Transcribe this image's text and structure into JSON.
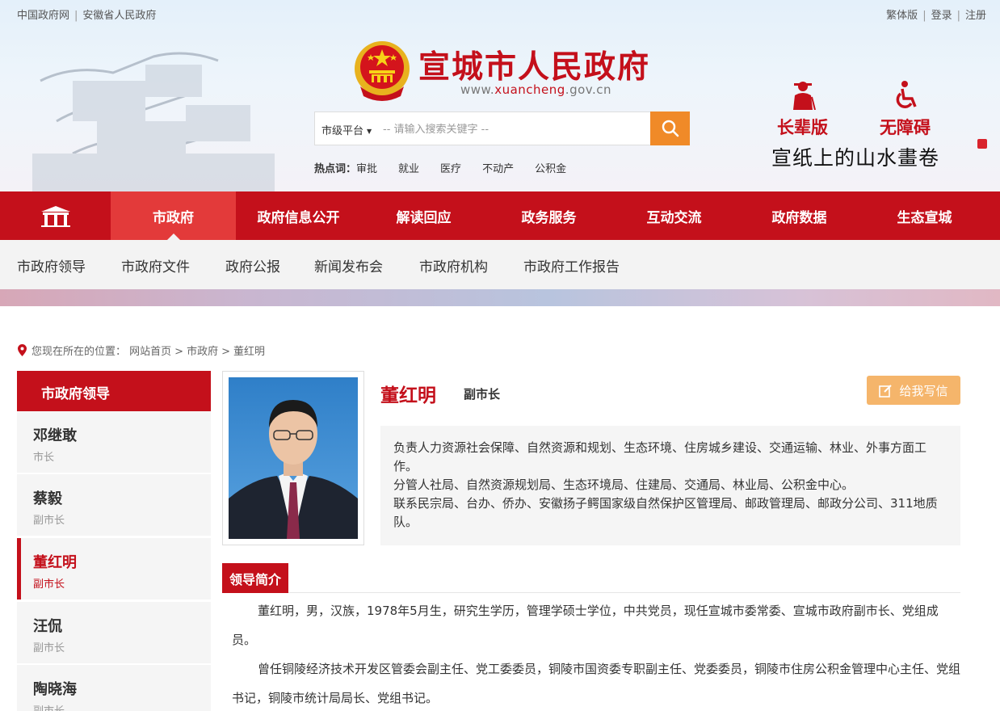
{
  "topbar": {
    "left_links": [
      "中国政府网",
      "安徽省人民政府"
    ],
    "right_links": [
      "繁体版",
      "登录",
      "注册"
    ]
  },
  "header": {
    "title": "宣城市人民政府",
    "url_prefix": "www.",
    "url_highlight": "xuancheng",
    "url_suffix": ".gov.cn",
    "search": {
      "scope": "市级平台",
      "placeholder": "-- 请输入搜索关键字 --"
    },
    "hot_label": "热点词：",
    "hot_words": [
      "审批",
      "就业",
      "医疗",
      "不动产",
      "公积金"
    ],
    "access": {
      "elder": "长辈版",
      "barrier_free": "无障碍"
    },
    "slogan": "宣纸上的山水畫卷"
  },
  "main_nav": [
    "市政府",
    "政府信息公开",
    "解读回应",
    "政务服务",
    "互动交流",
    "政府数据",
    "生态宣城"
  ],
  "sub_nav": [
    "市政府领导",
    "市政府文件",
    "政府公报",
    "新闻发布会",
    "市政府机构",
    "市政府工作报告"
  ],
  "breadcrumb": {
    "prefix": "您现在所在的位置：",
    "items": [
      "网站首页",
      "市政府",
      "董红明"
    ]
  },
  "sidebar": {
    "title": "市政府领导",
    "leaders": [
      {
        "name": "邓继敢",
        "title": "市长"
      },
      {
        "name": "蔡毅",
        "title": "副市长"
      },
      {
        "name": "董红明",
        "title": "副市长"
      },
      {
        "name": "汪侃",
        "title": "副市长"
      },
      {
        "name": "陶晓海",
        "title": "副市长"
      }
    ]
  },
  "profile": {
    "name": "董红明",
    "title": "副市长",
    "letter_button": "给我写信",
    "duties": [
      "负责人力资源社会保障、自然资源和规划、生态环境、住房城乡建设、交通运输、林业、外事方面工作。",
      "分管人社局、自然资源规划局、生态环境局、住建局、交通局、林业局、公积金中心。",
      "联系民宗局、台办、侨办、安徽扬子鳄国家级自然保护区管理局、邮政管理局、邮政分公司、311地质队。"
    ],
    "bio_heading": "领导简介",
    "bio": [
      "董红明，男，汉族，1978年5月生，研究生学历，管理学硕士学位，中共党员，现任宣城市委常委、宣城市政府副市长、党组成员。",
      "曾任铜陵经济技术开发区管委会副主任、党工委委员，铜陵市国资委专职副主任、党委委员，铜陵市住房公积金管理中心主任、党组书记，铜陵市统计局局长、党组书记。"
    ]
  },
  "colors": {
    "brand_red": "#c4101b",
    "nav_active": "#e33a3a",
    "search_button": "#f08a28",
    "letter_button": "#f5b56b"
  }
}
